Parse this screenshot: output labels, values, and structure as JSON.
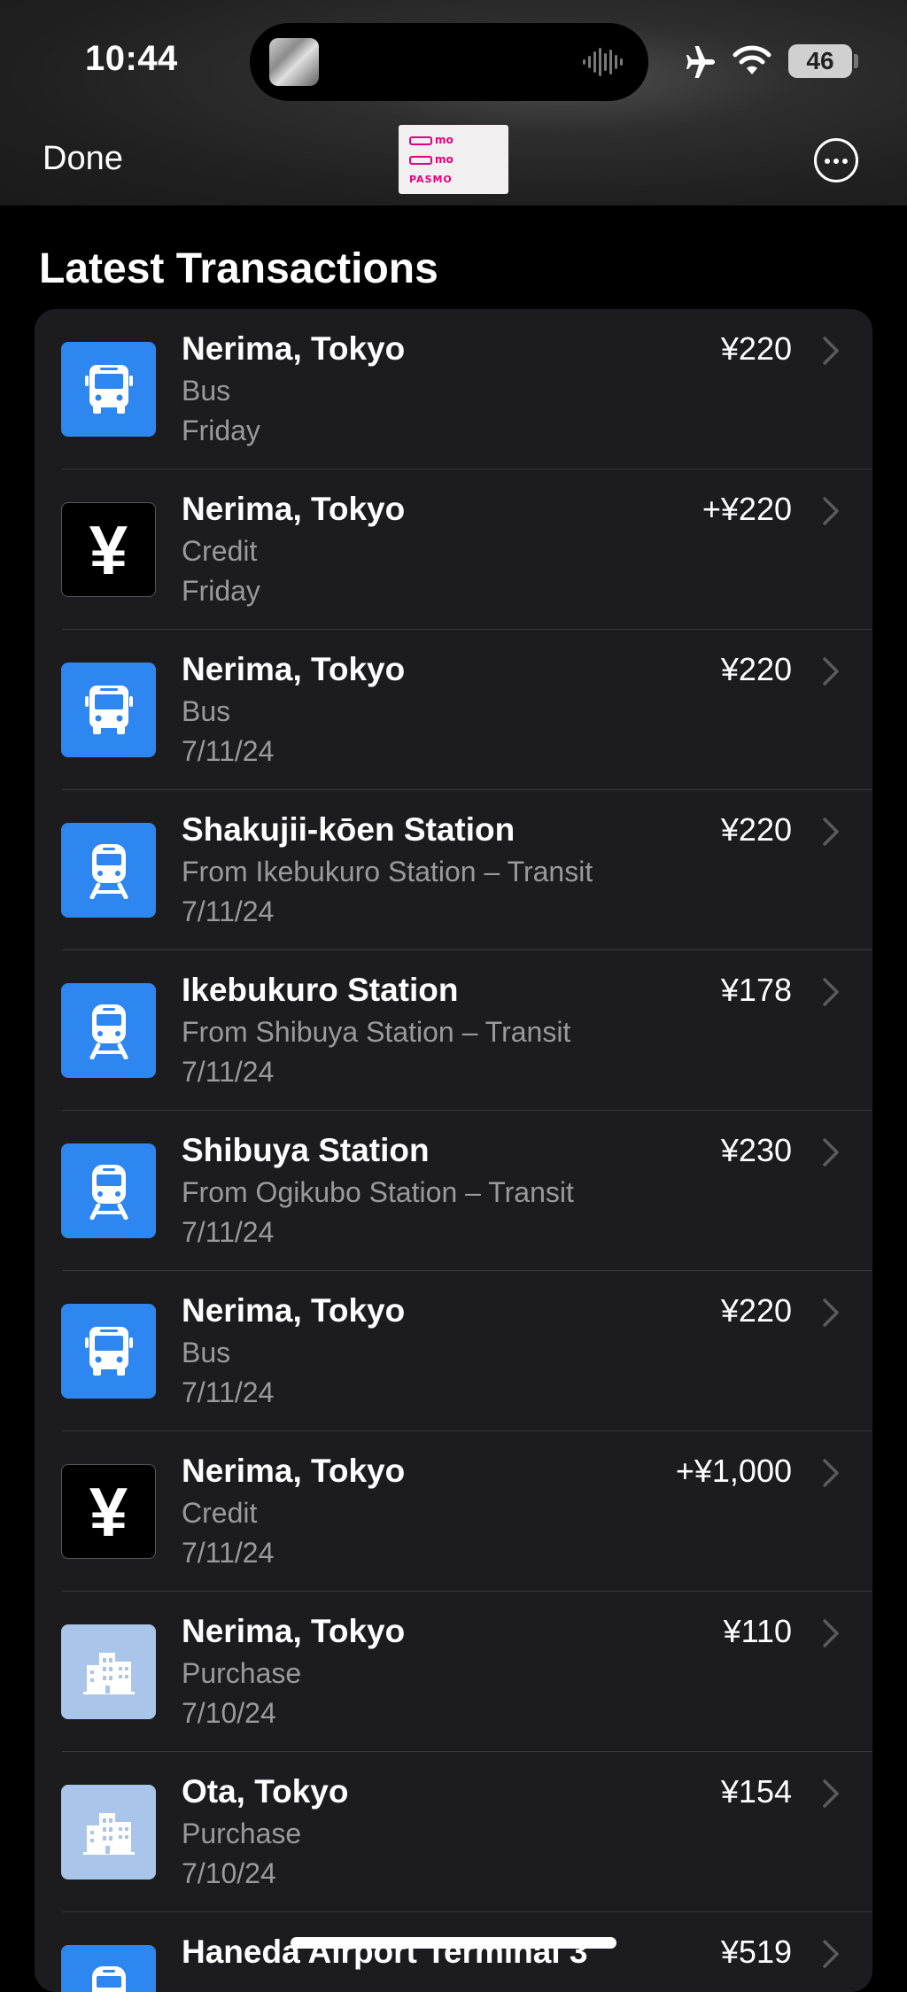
{
  "status_bar": {
    "time": "10:44",
    "battery": "46",
    "icons": [
      "airplane-icon",
      "wifi-icon",
      "battery-icon"
    ]
  },
  "nav": {
    "done_label": "Done",
    "card_name": "PASMO",
    "card_mark_1": "mo",
    "card_mark_2": "mo",
    "more_icon": "ellipsis-circle-icon"
  },
  "section_title": "Latest Transactions",
  "colors": {
    "accent_blue": "#2e86f0",
    "purchase_icon": "#a9c6ea",
    "list_bg": "#1c1c1e",
    "secondary_text": "#9a9a9e",
    "pasmo_pink": "#e4007f"
  },
  "transactions": [
    {
      "icon": "bus",
      "title": "Nerima, Tokyo",
      "subtitle": "Bus",
      "date": "Friday",
      "amount": "¥220"
    },
    {
      "icon": "credit",
      "title": "Nerima, Tokyo",
      "subtitle": "Credit",
      "date": "Friday",
      "amount": "+¥220"
    },
    {
      "icon": "bus",
      "title": "Nerima, Tokyo",
      "subtitle": "Bus",
      "date": "7/11/24",
      "amount": "¥220"
    },
    {
      "icon": "train",
      "title": "Shakujii-kōen Station",
      "subtitle": "From Ikebukuro Station – Transit",
      "date": "7/11/24",
      "amount": "¥220"
    },
    {
      "icon": "train",
      "title": "Ikebukuro Station",
      "subtitle": "From Shibuya Station – Transit",
      "date": "7/11/24",
      "amount": "¥178"
    },
    {
      "icon": "train",
      "title": "Shibuya Station",
      "subtitle": "From Ogikubo Station – Transit",
      "date": "7/11/24",
      "amount": "¥230"
    },
    {
      "icon": "bus",
      "title": "Nerima, Tokyo",
      "subtitle": "Bus",
      "date": "7/11/24",
      "amount": "¥220"
    },
    {
      "icon": "credit",
      "title": "Nerima, Tokyo",
      "subtitle": "Credit",
      "date": "7/11/24",
      "amount": "+¥1,000"
    },
    {
      "icon": "purchase",
      "title": "Nerima, Tokyo",
      "subtitle": "Purchase",
      "date": "7/10/24",
      "amount": "¥110"
    },
    {
      "icon": "purchase",
      "title": "Ota, Tokyo",
      "subtitle": "Purchase",
      "date": "7/10/24",
      "amount": "¥154"
    },
    {
      "icon": "train",
      "title": "Haneda Airport Terminal 3",
      "subtitle": "",
      "date": "",
      "amount": "¥519"
    }
  ]
}
